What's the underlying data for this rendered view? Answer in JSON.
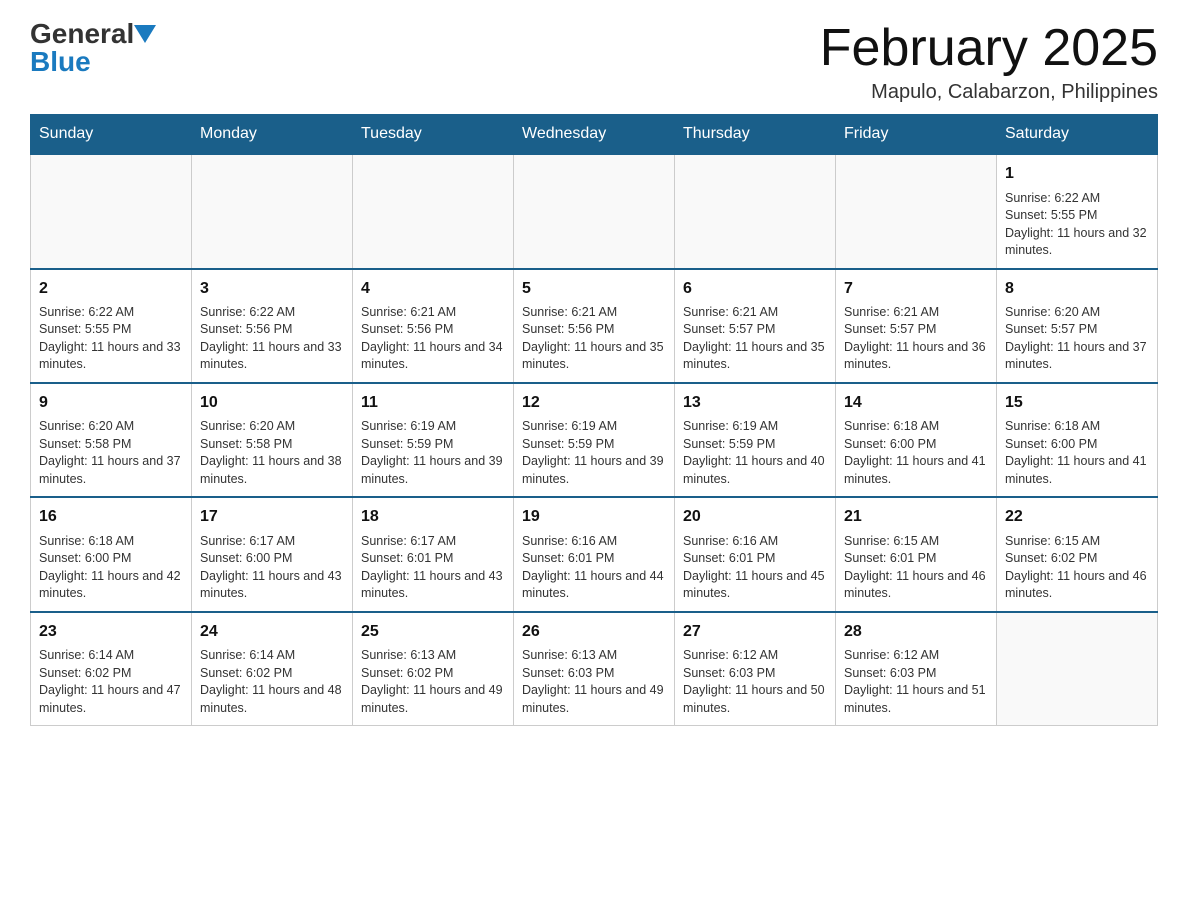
{
  "header": {
    "logo": {
      "general_text": "General",
      "blue_text": "Blue"
    },
    "title": "February 2025",
    "location": "Mapulo, Calabarzon, Philippines"
  },
  "weekdays": [
    "Sunday",
    "Monday",
    "Tuesday",
    "Wednesday",
    "Thursday",
    "Friday",
    "Saturday"
  ],
  "weeks": [
    [
      {
        "day": "",
        "info": ""
      },
      {
        "day": "",
        "info": ""
      },
      {
        "day": "",
        "info": ""
      },
      {
        "day": "",
        "info": ""
      },
      {
        "day": "",
        "info": ""
      },
      {
        "day": "",
        "info": ""
      },
      {
        "day": "1",
        "info": "Sunrise: 6:22 AM\nSunset: 5:55 PM\nDaylight: 11 hours and 32 minutes."
      }
    ],
    [
      {
        "day": "2",
        "info": "Sunrise: 6:22 AM\nSunset: 5:55 PM\nDaylight: 11 hours and 33 minutes."
      },
      {
        "day": "3",
        "info": "Sunrise: 6:22 AM\nSunset: 5:56 PM\nDaylight: 11 hours and 33 minutes."
      },
      {
        "day": "4",
        "info": "Sunrise: 6:21 AM\nSunset: 5:56 PM\nDaylight: 11 hours and 34 minutes."
      },
      {
        "day": "5",
        "info": "Sunrise: 6:21 AM\nSunset: 5:56 PM\nDaylight: 11 hours and 35 minutes."
      },
      {
        "day": "6",
        "info": "Sunrise: 6:21 AM\nSunset: 5:57 PM\nDaylight: 11 hours and 35 minutes."
      },
      {
        "day": "7",
        "info": "Sunrise: 6:21 AM\nSunset: 5:57 PM\nDaylight: 11 hours and 36 minutes."
      },
      {
        "day": "8",
        "info": "Sunrise: 6:20 AM\nSunset: 5:57 PM\nDaylight: 11 hours and 37 minutes."
      }
    ],
    [
      {
        "day": "9",
        "info": "Sunrise: 6:20 AM\nSunset: 5:58 PM\nDaylight: 11 hours and 37 minutes."
      },
      {
        "day": "10",
        "info": "Sunrise: 6:20 AM\nSunset: 5:58 PM\nDaylight: 11 hours and 38 minutes."
      },
      {
        "day": "11",
        "info": "Sunrise: 6:19 AM\nSunset: 5:59 PM\nDaylight: 11 hours and 39 minutes."
      },
      {
        "day": "12",
        "info": "Sunrise: 6:19 AM\nSunset: 5:59 PM\nDaylight: 11 hours and 39 minutes."
      },
      {
        "day": "13",
        "info": "Sunrise: 6:19 AM\nSunset: 5:59 PM\nDaylight: 11 hours and 40 minutes."
      },
      {
        "day": "14",
        "info": "Sunrise: 6:18 AM\nSunset: 6:00 PM\nDaylight: 11 hours and 41 minutes."
      },
      {
        "day": "15",
        "info": "Sunrise: 6:18 AM\nSunset: 6:00 PM\nDaylight: 11 hours and 41 minutes."
      }
    ],
    [
      {
        "day": "16",
        "info": "Sunrise: 6:18 AM\nSunset: 6:00 PM\nDaylight: 11 hours and 42 minutes."
      },
      {
        "day": "17",
        "info": "Sunrise: 6:17 AM\nSunset: 6:00 PM\nDaylight: 11 hours and 43 minutes."
      },
      {
        "day": "18",
        "info": "Sunrise: 6:17 AM\nSunset: 6:01 PM\nDaylight: 11 hours and 43 minutes."
      },
      {
        "day": "19",
        "info": "Sunrise: 6:16 AM\nSunset: 6:01 PM\nDaylight: 11 hours and 44 minutes."
      },
      {
        "day": "20",
        "info": "Sunrise: 6:16 AM\nSunset: 6:01 PM\nDaylight: 11 hours and 45 minutes."
      },
      {
        "day": "21",
        "info": "Sunrise: 6:15 AM\nSunset: 6:01 PM\nDaylight: 11 hours and 46 minutes."
      },
      {
        "day": "22",
        "info": "Sunrise: 6:15 AM\nSunset: 6:02 PM\nDaylight: 11 hours and 46 minutes."
      }
    ],
    [
      {
        "day": "23",
        "info": "Sunrise: 6:14 AM\nSunset: 6:02 PM\nDaylight: 11 hours and 47 minutes."
      },
      {
        "day": "24",
        "info": "Sunrise: 6:14 AM\nSunset: 6:02 PM\nDaylight: 11 hours and 48 minutes."
      },
      {
        "day": "25",
        "info": "Sunrise: 6:13 AM\nSunset: 6:02 PM\nDaylight: 11 hours and 49 minutes."
      },
      {
        "day": "26",
        "info": "Sunrise: 6:13 AM\nSunset: 6:03 PM\nDaylight: 11 hours and 49 minutes."
      },
      {
        "day": "27",
        "info": "Sunrise: 6:12 AM\nSunset: 6:03 PM\nDaylight: 11 hours and 50 minutes."
      },
      {
        "day": "28",
        "info": "Sunrise: 6:12 AM\nSunset: 6:03 PM\nDaylight: 11 hours and 51 minutes."
      },
      {
        "day": "",
        "info": ""
      }
    ]
  ]
}
